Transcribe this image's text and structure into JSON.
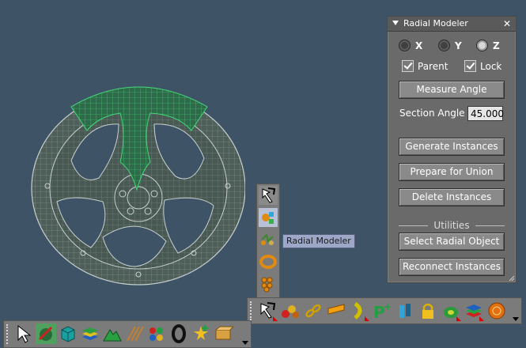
{
  "panel": {
    "title": "Radial Modeler",
    "close_glyph": "✕",
    "axes": [
      {
        "label": "X",
        "selected": false
      },
      {
        "label": "Y",
        "selected": false
      },
      {
        "label": "Z",
        "selected": true
      }
    ],
    "checkboxes": [
      {
        "label": "Parent",
        "checked": true
      },
      {
        "label": "Lock",
        "checked": true
      }
    ],
    "measure_angle_label": "Measure Angle",
    "section_angle_label": "Section Angle",
    "section_angle_value": "45.000",
    "generate_label": "Generate Instances",
    "prepare_label": "Prepare for Union",
    "delete_label": "Delete Instances",
    "utilities_label": "Utilities",
    "select_radial_label": "Select Radial Object",
    "reconnect_label": "Reconnect Instances"
  },
  "tooltip": {
    "text": "Radial Modeler"
  },
  "vertical_toolbar": {
    "icons": [
      "radial-modeler-cursor-icon",
      "radial-modeler-tool-icon",
      "array-tool-icon",
      "torus-array-icon",
      "grid-array-icon"
    ]
  },
  "bottom_toolbar_right": {
    "icons": [
      "curve-cursor-icon",
      "spheres-icon",
      "chain-icon",
      "text-extrude-icon",
      "curve-path-icon",
      "point-plus-icon",
      "extrude-icon",
      "lock-icon",
      "ring-icon",
      "layers-icon",
      "orange-sphere-icon"
    ]
  },
  "bottom_toolbar_left": {
    "icons": [
      "select-arrow-icon",
      "paint-icon",
      "cube-icon",
      "layers-stack-icon",
      "terrain-icon",
      "parallel-lines-icon",
      "dots-icon",
      "torus-icon",
      "star-plus-icon",
      "box-texture-icon"
    ]
  },
  "colors": {
    "viewport_bg": "#3f5366",
    "wireframe": "#c8d0d0",
    "selected_wireframe": "#44d878",
    "panel_bg": "#6a6a6a"
  }
}
